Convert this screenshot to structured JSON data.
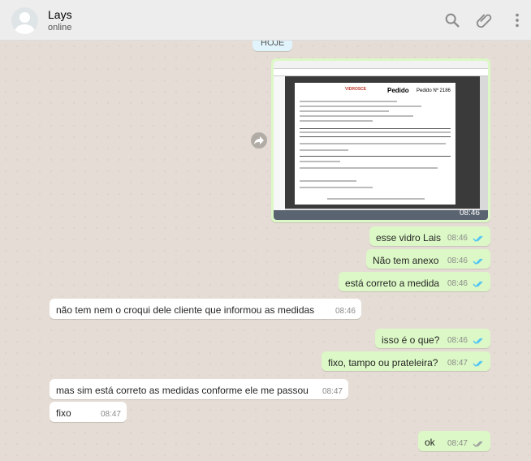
{
  "header": {
    "contact_name": "Lays",
    "contact_status": "online",
    "icons": [
      "search-icon",
      "attach-icon",
      "menu-icon"
    ]
  },
  "chat": {
    "date_chip": "HOJE",
    "image_message": {
      "time": "08:46",
      "document": {
        "brand": "VIDROSCE",
        "title": "Pedido",
        "number": "Pedido Nº 2186"
      }
    },
    "messages": [
      {
        "dir": "out",
        "text": "esse vidro Lais",
        "time": "08:46"
      },
      {
        "dir": "out",
        "text": "Não tem anexo",
        "time": "08:46"
      },
      {
        "dir": "out",
        "text": "está correto a medida",
        "time": "08:46"
      },
      {
        "dir": "in",
        "text": "não tem nem o croqui dele cliente que informou as medidas",
        "time": "08:46"
      },
      {
        "dir": "out",
        "text": "isso é o que?",
        "time": "08:46"
      },
      {
        "dir": "out",
        "text": "fixo, tampo ou prateleira?",
        "time": "08:47"
      },
      {
        "dir": "in",
        "text": "mas sim está correto as medidas conforme ele me passou",
        "time": "08:47"
      },
      {
        "dir": "in",
        "text": "fixo",
        "time": "08:47"
      },
      {
        "dir": "out",
        "text": "ok",
        "time": "08:47"
      }
    ]
  },
  "colors": {
    "outgoing_bubble": "#dcf8c6",
    "incoming_bubble": "#ffffff",
    "read_ticks": "#4fc3f7",
    "delivered_ticks": "#9e9e9e",
    "header_bg": "#ededed",
    "chat_bg": "#e5ddd5"
  }
}
